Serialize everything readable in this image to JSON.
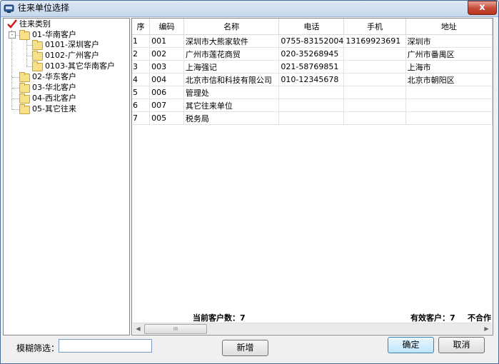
{
  "window": {
    "title": "往来单位选择",
    "close_glyph": "x"
  },
  "tree": {
    "root": "往来类别",
    "nodes": [
      {
        "label": "01-华南客户",
        "expander": "-"
      },
      {
        "label": "0101-深圳客户"
      },
      {
        "label": "0102-广州客户"
      },
      {
        "label": "0103-其它华南客户"
      },
      {
        "label": "02-华东客户"
      },
      {
        "label": "03-华北客户"
      },
      {
        "label": "04-西北客户"
      },
      {
        "label": "05-其它往来"
      }
    ]
  },
  "grid": {
    "columns": [
      "序",
      "编码",
      "名称",
      "电话",
      "手机",
      "地址"
    ],
    "rows": [
      {
        "seq": "1",
        "code": "001",
        "name": "深圳市大熊家软件",
        "phone": "0755-83152004",
        "mobile": "13169923691",
        "address": "深圳市"
      },
      {
        "seq": "2",
        "code": "002",
        "name": "广州市莲花商贸",
        "phone": "020-35268945",
        "mobile": "",
        "address": "广州市番禺区"
      },
      {
        "seq": "3",
        "code": "003",
        "name": "上海强记",
        "phone": "021-58769851",
        "mobile": "",
        "address": "上海市"
      },
      {
        "seq": "4",
        "code": "004",
        "name": "北京市信和科技有限公司",
        "phone": "010-12345678",
        "mobile": "",
        "address": "北京市朝阳区"
      },
      {
        "seq": "5",
        "code": "006",
        "name": "管理处",
        "phone": "",
        "mobile": "",
        "address": ""
      },
      {
        "seq": "6",
        "code": "007",
        "name": "其它往来单位",
        "phone": "",
        "mobile": "",
        "address": ""
      },
      {
        "seq": "7",
        "code": "005",
        "name": "税务局",
        "phone": "",
        "mobile": "",
        "address": ""
      }
    ],
    "footer": {
      "current_count": "当前客户数：7",
      "valid_count": "有效客户：7",
      "inactive": "不合作"
    },
    "scroll_thumb_grip": "III"
  },
  "bottom": {
    "filter_label": "模糊筛选：",
    "filter_value": "",
    "add_label": "新增",
    "ok_label": "确定",
    "cancel_label": "取消"
  }
}
